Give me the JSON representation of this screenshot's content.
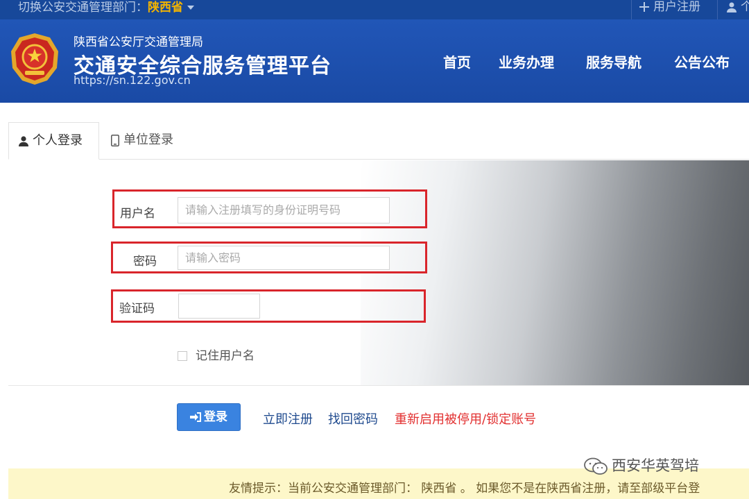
{
  "topbar": {
    "switch_prefix": "切换公安交通管理部门：",
    "switch_value": "陕西省",
    "register": "用户注册",
    "user_short": "个"
  },
  "header": {
    "bureau": "陕西省公安厅交通管理局",
    "platform": "交通安全综合服务管理平台",
    "url": "https://sn.122.gov.cn",
    "nav": [
      "首页",
      "业务办理",
      "服务导航",
      "公告公布"
    ]
  },
  "tabs": {
    "personal": "个人登录",
    "unit": "单位登录"
  },
  "form": {
    "username_label": "用户名",
    "username_placeholder": "请输入注册填写的身份证明号码",
    "password_label": "密码",
    "password_placeholder": "请输入密码",
    "captcha_label": "验证码",
    "remember": "记住用户名"
  },
  "actions": {
    "login": "登录",
    "register_now": "立即注册",
    "retrieve_password": "找回密码",
    "reactivate": "重新启用被停用/锁定账号"
  },
  "notice": {
    "text": "友情提示：当前公安交通管理部门： 陕西省 。 如果您不是在陕西省注册，请至部级平台登"
  },
  "watermark": "西安华英驾培",
  "colors": {
    "header_blue": "#1a4aa5",
    "accent_yellow": "#f3b400",
    "highlight_red": "#d9252b",
    "button_blue": "#3a83e0",
    "link_red": "#e23030",
    "notice_bg": "#fdf7c9"
  }
}
